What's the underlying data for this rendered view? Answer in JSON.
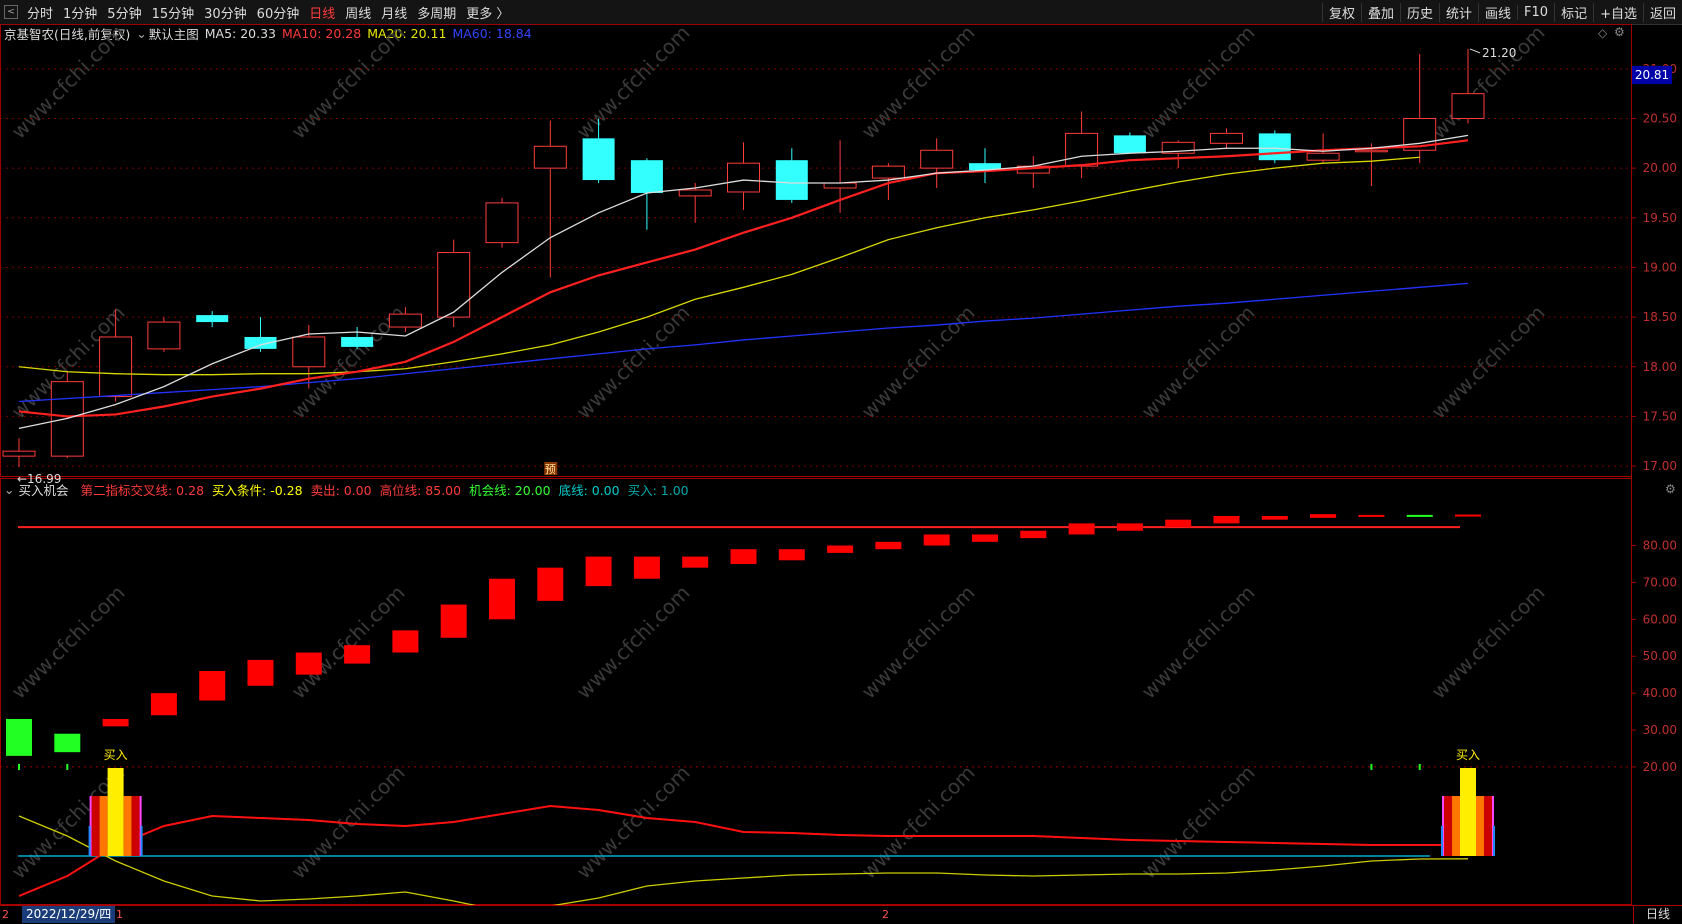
{
  "toolbar": {
    "left": [
      "分时",
      "1分钟",
      "5分钟",
      "15分钟",
      "30分钟",
      "60分钟",
      "日线",
      "周线",
      "月线",
      "多周期",
      "更多 〉"
    ],
    "active": "日线",
    "right": [
      "复权",
      "叠加",
      "历史",
      "统计",
      "画线",
      "F10",
      "标记",
      "+自选",
      "返回"
    ]
  },
  "main_header": {
    "stock": "京基智农(日线,前复权)",
    "template": "默认主图",
    "ma5": "MA5: 20.33",
    "ma10": "MA10: 20.28",
    "ma20": "MA20: 20.11",
    "ma60": "MA60: 18.84"
  },
  "sub_header": {
    "name": "买入机会",
    "items": [
      {
        "text": "第二指标交叉线: 0.28",
        "color": "#ff3b3b"
      },
      {
        "text": "买入条件: -0.28",
        "color": "#ffff00"
      },
      {
        "text": "卖出: 0.00",
        "color": "#ff3b3b"
      },
      {
        "text": "高位线: 85.00",
        "color": "#ff3b3b"
      },
      {
        "text": "机会线: 20.00",
        "color": "#33ff33"
      },
      {
        "text": "底线: 0.00",
        "color": "#00cccc"
      },
      {
        "text": "买入: 1.00",
        "color": "#00aaaa"
      }
    ]
  },
  "annotations": {
    "high_label": "21.20",
    "low_label": "←16.99",
    "pre_marker": "预",
    "buy1": "买入",
    "buy2": "买入",
    "current_price": "20.81"
  },
  "price_axis_ticks": [
    "21.00",
    "20.50",
    "20.00",
    "19.50",
    "19.00",
    "18.50",
    "18.00",
    "17.50",
    "17.00"
  ],
  "indicator_axis_ticks": [
    "80.00",
    "70.00",
    "60.00",
    "50.00",
    "40.00",
    "30.00",
    "20.00"
  ],
  "bottom": {
    "date": "2022/12/29/四",
    "marker1": "1",
    "marker2": "2",
    "period_tab": "日线"
  },
  "watermark": "www.cfchi.com",
  "colors": {
    "up": "#ff3b3b",
    "down": "#33ffff",
    "ma5": "#dddddd",
    "ma10": "#ff2020",
    "ma20": "#d8d800",
    "ma60": "#2233ff"
  },
  "chart_data": {
    "type": "candlestick",
    "y_range": [
      16.9,
      21.25
    ],
    "candles": [
      {
        "o": 17.1,
        "h": 17.28,
        "l": 16.99,
        "c": 17.15
      },
      {
        "o": 17.1,
        "h": 17.95,
        "l": 17.08,
        "c": 17.85
      },
      {
        "o": 17.7,
        "h": 18.58,
        "l": 17.65,
        "c": 18.3
      },
      {
        "o": 18.18,
        "h": 18.5,
        "l": 18.15,
        "c": 18.45
      },
      {
        "o": 18.52,
        "h": 18.56,
        "l": 18.4,
        "c": 18.45
      },
      {
        "o": 18.3,
        "h": 18.5,
        "l": 18.15,
        "c": 18.18
      },
      {
        "o": 18.0,
        "h": 18.42,
        "l": 17.78,
        "c": 18.3
      },
      {
        "o": 18.3,
        "h": 18.4,
        "l": 18.18,
        "c": 18.2
      },
      {
        "o": 18.4,
        "h": 18.6,
        "l": 18.35,
        "c": 18.53
      },
      {
        "o": 18.5,
        "h": 19.28,
        "l": 18.4,
        "c": 19.15
      },
      {
        "o": 19.25,
        "h": 19.7,
        "l": 19.2,
        "c": 19.65
      },
      {
        "o": 20.0,
        "h": 20.48,
        "l": 18.9,
        "c": 20.22
      },
      {
        "o": 20.3,
        "h": 20.5,
        "l": 19.85,
        "c": 19.88
      },
      {
        "o": 20.08,
        "h": 20.1,
        "l": 19.38,
        "c": 19.75
      },
      {
        "o": 19.72,
        "h": 19.85,
        "l": 19.45,
        "c": 19.78
      },
      {
        "o": 19.76,
        "h": 20.26,
        "l": 19.58,
        "c": 20.05
      },
      {
        "o": 20.08,
        "h": 20.2,
        "l": 19.65,
        "c": 19.68
      },
      {
        "o": 19.8,
        "h": 20.28,
        "l": 19.55,
        "c": 19.85
      },
      {
        "o": 19.9,
        "h": 20.05,
        "l": 19.68,
        "c": 20.02
      },
      {
        "o": 20.0,
        "h": 20.3,
        "l": 19.8,
        "c": 20.18
      },
      {
        "o": 20.05,
        "h": 20.2,
        "l": 19.85,
        "c": 19.98
      },
      {
        "o": 19.95,
        "h": 20.12,
        "l": 19.8,
        "c": 20.02
      },
      {
        "o": 20.02,
        "h": 20.57,
        "l": 19.9,
        "c": 20.35
      },
      {
        "o": 20.33,
        "h": 20.36,
        "l": 20.18,
        "c": 20.15
      },
      {
        "o": 20.15,
        "h": 20.28,
        "l": 20.0,
        "c": 20.26
      },
      {
        "o": 20.25,
        "h": 20.4,
        "l": 20.2,
        "c": 20.35
      },
      {
        "o": 20.35,
        "h": 20.38,
        "l": 20.05,
        "c": 20.08
      },
      {
        "o": 20.08,
        "h": 20.35,
        "l": 20.05,
        "c": 20.15
      },
      {
        "o": 20.18,
        "h": 20.25,
        "l": 19.82,
        "c": 20.18
      },
      {
        "o": 20.18,
        "h": 21.15,
        "l": 20.05,
        "c": 20.5
      },
      {
        "o": 20.5,
        "h": 21.2,
        "l": 20.45,
        "c": 20.75
      }
    ],
    "ma5": [
      17.38,
      17.48,
      17.62,
      17.8,
      18.03,
      18.22,
      18.33,
      18.35,
      18.31,
      18.55,
      18.95,
      19.3,
      19.55,
      19.75,
      19.8,
      19.88,
      19.85,
      19.85,
      19.88,
      19.95,
      19.98,
      20.02,
      20.12,
      20.15,
      20.17,
      20.2,
      20.2,
      20.17,
      20.2,
      20.25,
      20.33
    ],
    "ma10": [
      17.55,
      17.5,
      17.52,
      17.6,
      17.7,
      17.78,
      17.88,
      17.95,
      18.05,
      18.25,
      18.5,
      18.75,
      18.92,
      19.05,
      19.18,
      19.35,
      19.5,
      19.68,
      19.85,
      19.95,
      19.97,
      20.0,
      20.03,
      20.08,
      20.1,
      20.12,
      20.15,
      20.18,
      20.2,
      20.22,
      20.28
    ],
    "ma20": [
      18.0,
      17.95,
      17.93,
      17.92,
      17.92,
      17.93,
      17.93,
      17.95,
      17.98,
      18.05,
      18.13,
      18.22,
      18.35,
      18.5,
      18.68,
      18.8,
      18.93,
      19.1,
      19.28,
      19.4,
      19.5,
      19.58,
      19.67,
      19.77,
      19.86,
      19.94,
      20.0,
      20.05,
      20.07,
      20.11
    ],
    "ma60": [
      17.65,
      17.68,
      17.71,
      17.74,
      17.77,
      17.8,
      17.84,
      17.88,
      17.93,
      17.98,
      18.03,
      18.08,
      18.13,
      18.18,
      18.22,
      18.27,
      18.31,
      18.35,
      18.39,
      18.42,
      18.46,
      18.49,
      18.53,
      18.57,
      18.61,
      18.64,
      18.68,
      18.72,
      18.76,
      18.8,
      18.84
    ],
    "indicator": {
      "y_range": [
        0,
        100
      ],
      "high_line": 85,
      "chance_line": 20,
      "bars": [
        {
          "lo": 23,
          "hi": 33,
          "c": "green"
        },
        {
          "lo": 24,
          "hi": 29,
          "c": "green"
        },
        {
          "lo": 31,
          "hi": 33,
          "c": "red"
        },
        {
          "lo": 34,
          "hi": 40,
          "c": "red"
        },
        {
          "lo": 38,
          "hi": 46,
          "c": "red"
        },
        {
          "lo": 42,
          "hi": 49,
          "c": "red"
        },
        {
          "lo": 45,
          "hi": 51,
          "c": "red"
        },
        {
          "lo": 48,
          "hi": 53,
          "c": "red"
        },
        {
          "lo": 51,
          "hi": 57,
          "c": "red"
        },
        {
          "lo": 55,
          "hi": 64,
          "c": "red"
        },
        {
          "lo": 60,
          "hi": 71,
          "c": "red"
        },
        {
          "lo": 65,
          "hi": 74,
          "c": "red"
        },
        {
          "lo": 69,
          "hi": 77,
          "c": "red"
        },
        {
          "lo": 71,
          "hi": 77,
          "c": "red"
        },
        {
          "lo": 74,
          "hi": 77,
          "c": "red"
        },
        {
          "lo": 75,
          "hi": 79,
          "c": "red"
        },
        {
          "lo": 76,
          "hi": 79,
          "c": "red"
        },
        {
          "lo": 78,
          "hi": 80,
          "c": "red"
        },
        {
          "lo": 79,
          "hi": 81,
          "c": "red"
        },
        {
          "lo": 80,
          "hi": 83,
          "c": "red"
        },
        {
          "lo": 81,
          "hi": 83,
          "c": "red"
        },
        {
          "lo": 82,
          "hi": 84,
          "c": "red"
        },
        {
          "lo": 83,
          "hi": 86,
          "c": "red"
        },
        {
          "lo": 84,
          "hi": 86,
          "c": "red"
        },
        {
          "lo": 85,
          "hi": 87,
          "c": "red"
        },
        {
          "lo": 86,
          "hi": 88,
          "c": "red"
        },
        {
          "lo": 87,
          "hi": 88,
          "c": "red"
        },
        {
          "lo": 87.5,
          "hi": 88.5,
          "c": "red"
        },
        {
          "lo": 88,
          "hi": 88.3,
          "c": "red"
        },
        {
          "lo": 88,
          "hi": 88.3,
          "c": "green"
        },
        {
          "lo": 88,
          "hi": 88.4,
          "c": "red"
        }
      ],
      "red_line": [
        -4,
        -2,
        1,
        3,
        4,
        3.8,
        3.6,
        3.2,
        3.0,
        3.4,
        4.2,
        5.0,
        4.6,
        3.8,
        3.4,
        2.4,
        2.3,
        2.1,
        2.0,
        2.0,
        2.0,
        2.0,
        1.8,
        1.6,
        1.5,
        1.4,
        1.3,
        1.2,
        1.1,
        1.1,
        1.1
      ],
      "yellow_line": [
        4,
        2,
        -0.5,
        -2.5,
        -4,
        -4.5,
        -4.3,
        -4,
        -3.6,
        -4.5,
        -5.5,
        -5,
        -4.2,
        -3,
        -2.5,
        -2.2,
        -1.9,
        -1.8,
        -1.7,
        -1.7,
        -1.9,
        -2.0,
        -1.9,
        -1.8,
        -1.8,
        -1.7,
        -1.4,
        -1.0,
        -0.5,
        -0.3,
        -0.28
      ],
      "buy_signals": [
        2,
        30
      ]
    }
  }
}
